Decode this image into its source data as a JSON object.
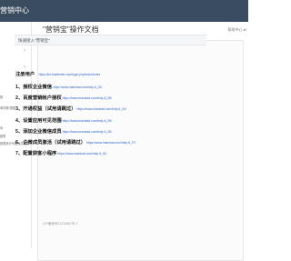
{
  "header": {
    "app_title": "营销中心",
    "bg_color": "#3a4c5f"
  },
  "sidebar": {
    "chevron": "›",
    "texts": [
      "报",
      "单列表/视图",
      "采",
      "报表",
      "报表统计代理汇总报表"
    ]
  },
  "page": {
    "title": "\"营销宝\"操作文档",
    "help_text": "帮助中心 ⇄",
    "notice": "快速接入\"营销宝\"",
    "register_label": "注册用户",
    "register_link": "https://tui.kuaifenbe.com/login.php/index/index",
    "steps": [
      {
        "label": "1、授权企业微信",
        "link": "https://www.mamirad.com/help-6_23/"
      },
      {
        "label": "2、百度营销帐户授权",
        "link": "https://www.mamirad.com/help-6_28/"
      },
      {
        "label": "3、开通权益（试用请跳过）",
        "link": "https://www.mamirad.com/help-6_24/"
      },
      {
        "label": "4、设置应用可见范围",
        "link": "https://www.mamirad.com/help-6_25/"
      },
      {
        "label": "5、添加企业微信成员",
        "link": "https://www.mamirad.com/help-6_26/"
      },
      {
        "label": "6、企微成员激活（试用请跳过）",
        "link": "https://www.mamirad.com/help-6_27/"
      },
      {
        "label": "7、配置获客小程序",
        "link": "https://www.mamirad.com/help-6_61/"
      }
    ],
    "footer": "ICP备案号01234567号-1"
  }
}
